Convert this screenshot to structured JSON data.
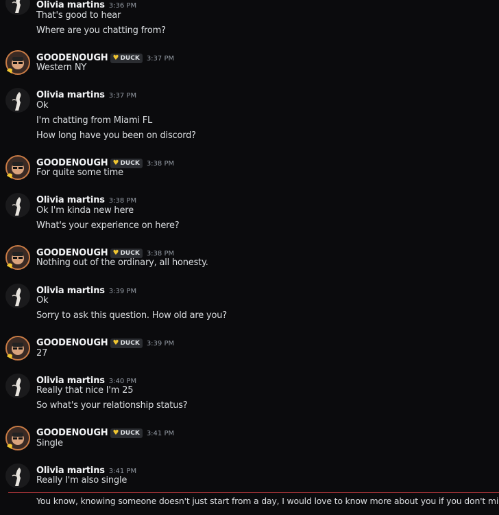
{
  "groups": [
    {
      "author": "Olivia martins",
      "time": "3:36 PM",
      "lines": [
        "That's good to hear",
        "Where are you chatting from?"
      ]
    },
    {
      "author": "GOODENOUGH",
      "tag": "DUCK",
      "tag_icon": "heart-icon",
      "time": "3:37 PM",
      "lines": [
        "Western NY"
      ]
    },
    {
      "author": "Olivia martins",
      "time": "3:37 PM",
      "lines": [
        "Ok",
        "I'm chatting from Miami FL",
        "How long have you been on discord?"
      ]
    },
    {
      "author": "GOODENOUGH",
      "tag": "DUCK",
      "tag_icon": "heart-icon",
      "time": "3:38 PM",
      "lines": [
        "For quite some time"
      ]
    },
    {
      "author": "Olivia martins",
      "time": "3:38 PM",
      "lines": [
        "Ok I'm kinda new here",
        "What's your experience on here?"
      ]
    },
    {
      "author": "GOODENOUGH",
      "tag": "DUCK",
      "tag_icon": "heart-icon",
      "time": "3:38 PM",
      "lines": [
        "Nothing out of the ordinary, all honesty."
      ]
    },
    {
      "author": "Olivia martins",
      "time": "3:39 PM",
      "lines": [
        "Ok",
        "Sorry to ask this question. How old are you?"
      ]
    },
    {
      "author": "GOODENOUGH",
      "tag": "DUCK",
      "tag_icon": "heart-icon",
      "time": "3:39 PM",
      "lines": [
        "27"
      ]
    },
    {
      "author": "Olivia martins",
      "time": "3:40 PM",
      "lines": [
        "Really that nice I'm 25",
        "So what's your relationship status?"
      ]
    },
    {
      "author": "GOODENOUGH",
      "tag": "DUCK",
      "tag_icon": "heart-icon",
      "time": "3:41 PM",
      "lines": [
        "Single"
      ]
    },
    {
      "author": "Olivia martins",
      "time": "3:41 PM",
      "lines": [
        "Really I'm also single"
      ]
    }
  ],
  "unread_message": "You know, knowing someone doesn't just start from a day, I would love to know more about you if you don't mind?",
  "colors": {
    "background": "#0b0b0d",
    "new_messages_divider": "#c03b3f",
    "tag_heart": "#f0c531"
  }
}
